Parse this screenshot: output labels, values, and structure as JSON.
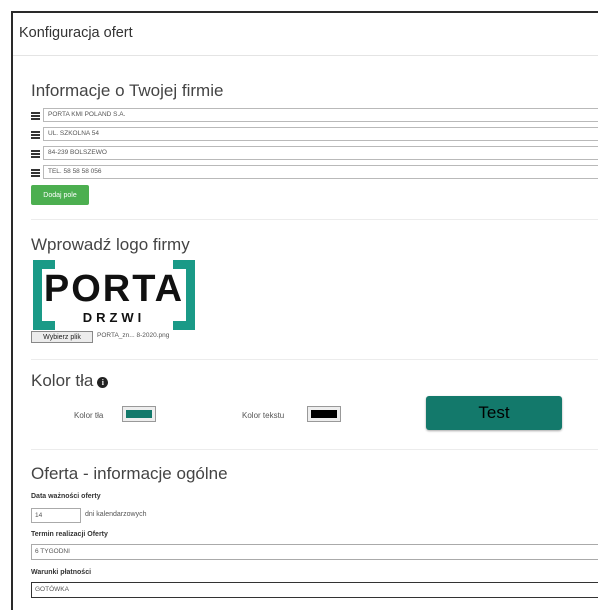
{
  "window": {
    "title": "Konfiguracja ofert"
  },
  "company_info": {
    "heading": "Informacje o Twojej firmie",
    "fields": [
      {
        "value": "PORTA KMI POLAND S.A."
      },
      {
        "value": "UL. SZKOLNA 54"
      },
      {
        "value": "84-239 BOLSZEWO"
      },
      {
        "value": "TEL. 58 58 58 056"
      }
    ],
    "add_button": "Dodaj pole"
  },
  "logo": {
    "heading": "Wprowadź logo firmy",
    "logo_text_main": "PORTA",
    "logo_text_sub": "DRZWI",
    "file_button": "Wybierz plik",
    "file_name": "PORTA_zn... 8-2020.png"
  },
  "colors": {
    "heading": "Kolor tła",
    "bg_label": "Kolor tła",
    "text_label": "Kolor tekstu",
    "bg_color": "#13796b",
    "text_color": "#000000",
    "test_button": "Test",
    "test_button_bg": "#13796b",
    "test_button_text": "#000000"
  },
  "offer": {
    "heading": "Oferta - informacje ogólne",
    "validity_label": "Data ważności oferty",
    "validity_value": "14",
    "validity_suffix": "dni kalendarzowych",
    "term_label": "Termin realizacji Oferty",
    "term_value": "6 TYGODNI",
    "payment_label": "Warunki płatności",
    "payment_value": "GOTÓWKA"
  },
  "theme": {
    "add_button_color": "#4caf50",
    "logo_accent": "#1a9a87"
  }
}
